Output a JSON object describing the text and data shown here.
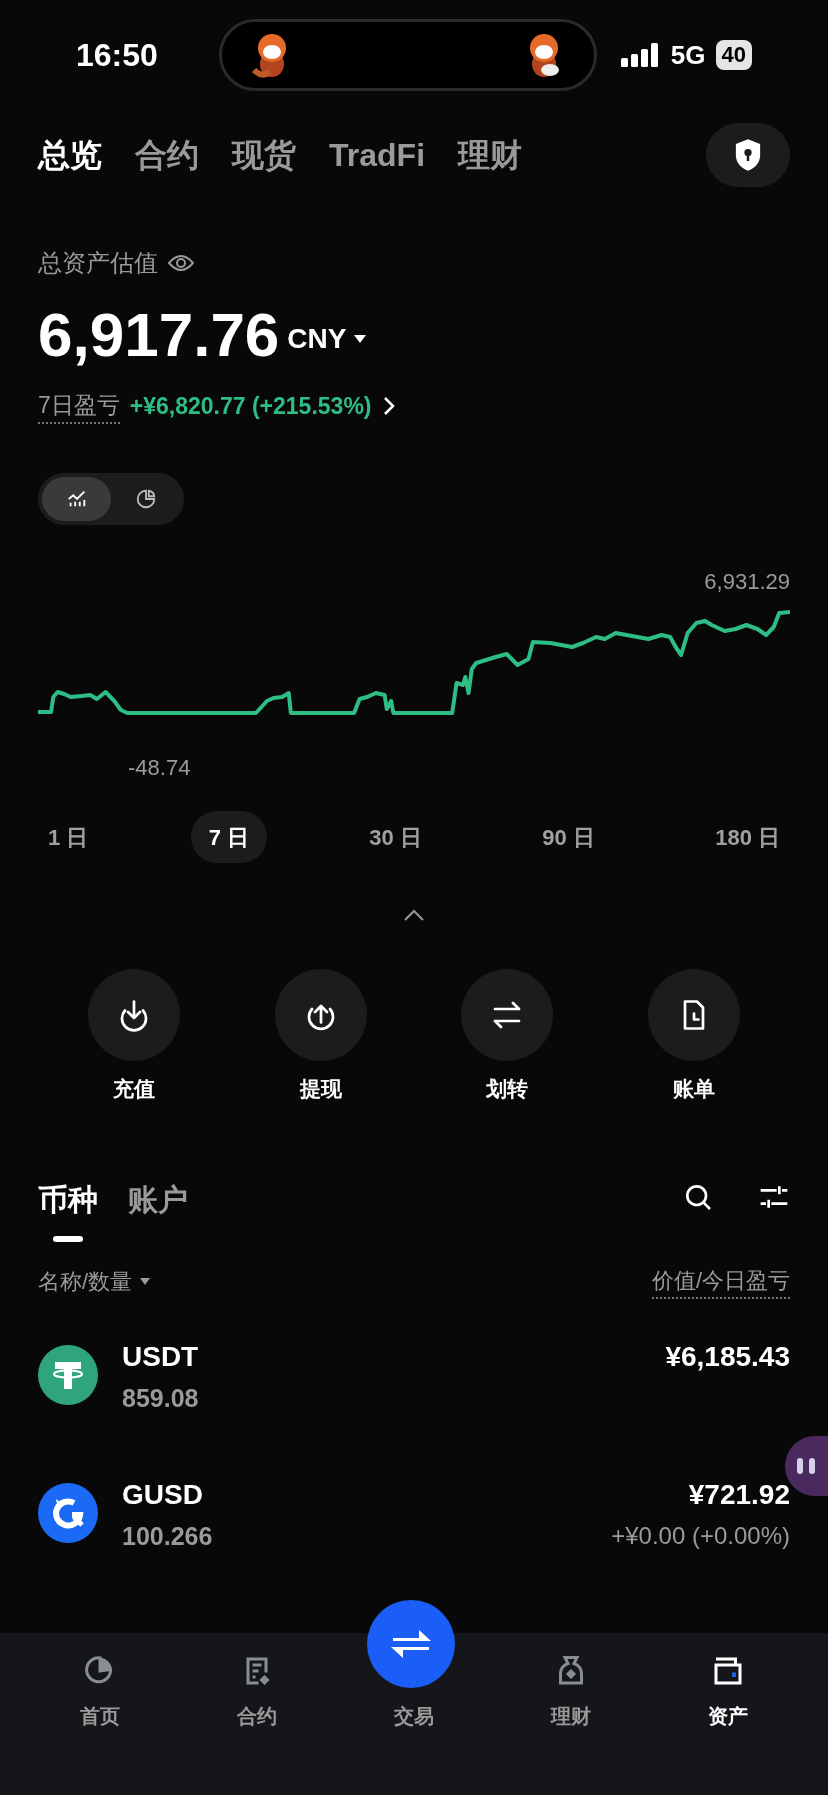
{
  "status_bar": {
    "time": "16:50",
    "network": "5G",
    "battery": "40"
  },
  "top_tabs": [
    {
      "label": "总览",
      "selected": true
    },
    {
      "label": "合约",
      "selected": false
    },
    {
      "label": "现货",
      "selected": false
    },
    {
      "label": "TradFi",
      "selected": false
    },
    {
      "label": "理财",
      "selected": false
    }
  ],
  "summary": {
    "label": "总资产估值",
    "amount": "6,917.76",
    "currency": "CNY",
    "pnl_label": "7日盈亏",
    "pnl_value": "+¥6,820.77 (+215.53%)"
  },
  "chart_modes": [
    {
      "kind": "line",
      "selected": true
    },
    {
      "kind": "pie",
      "selected": false
    }
  ],
  "chart": {
    "max_label": "6,931.29",
    "min_label": "-48.74"
  },
  "periods": [
    {
      "label": "1 日",
      "selected": false
    },
    {
      "label": "7 日",
      "selected": true
    },
    {
      "label": "30 日",
      "selected": false
    },
    {
      "label": "90 日",
      "selected": false
    },
    {
      "label": "180 日",
      "selected": false
    }
  ],
  "actions": [
    {
      "kind": "deposit",
      "label": "充值"
    },
    {
      "kind": "withdraw",
      "label": "提现"
    },
    {
      "kind": "transfer",
      "label": "划转"
    },
    {
      "kind": "bill",
      "label": "账单"
    }
  ],
  "asset_tabs": [
    {
      "label": "币种",
      "selected": true
    },
    {
      "label": "账户",
      "selected": false
    }
  ],
  "list_header": {
    "left": "名称/数量",
    "right": "价值/今日盈亏"
  },
  "assets": [
    {
      "kind": "tether",
      "name": "USDT",
      "quantity": "859.08",
      "value": "¥6,185.43"
    },
    {
      "kind": "gusd",
      "name": "GUSD",
      "quantity": "100.266",
      "value": "¥721.92",
      "pnl": "+¥0.00 (+0.00%)"
    }
  ],
  "bottom_nav": [
    {
      "kind": "home",
      "label": "首页",
      "selected": false
    },
    {
      "kind": "contract",
      "label": "合约",
      "selected": false
    },
    {
      "kind": "trade",
      "label": "交易",
      "selected": false
    },
    {
      "kind": "finance",
      "label": "理财",
      "selected": false
    },
    {
      "kind": "assets",
      "label": "资产",
      "selected": true
    }
  ]
}
